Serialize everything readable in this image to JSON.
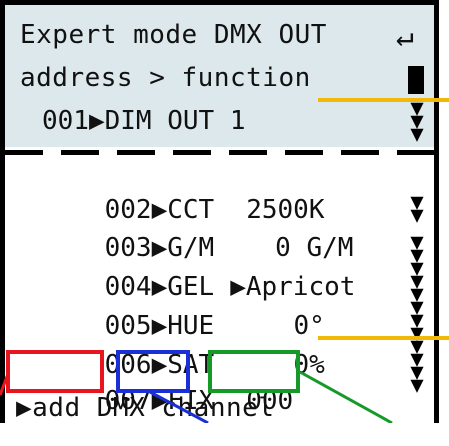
{
  "header": {
    "line1": "Expert mode DMX OUT",
    "line2": "address > function",
    "enter_icon": "enter-icon",
    "first_row": "001▶DIM OUT 1"
  },
  "rows": [
    {
      "addr": "002",
      "func": "CCT",
      "value": "2500K"
    },
    {
      "addr": "003",
      "func": "G/M",
      "value": "   0 G/M"
    },
    {
      "addr": "004",
      "func": "GEL",
      "value": "▶Apricot"
    },
    {
      "addr": "005",
      "func": "HUE",
      "value": "  0°"
    },
    {
      "addr": "006",
      "func": "SAT",
      "value": "  0%"
    },
    {
      "addr": "007",
      "func": "FIX",
      "value": "000"
    }
  ],
  "add_channel": "▶add DMX channel",
  "colors": {
    "header_bg": "#dde8ec",
    "highlight_red": "#e8141e",
    "highlight_blue": "#1a2fd6",
    "highlight_green": "#159a2a",
    "callout_yellow": "#f2b807"
  }
}
